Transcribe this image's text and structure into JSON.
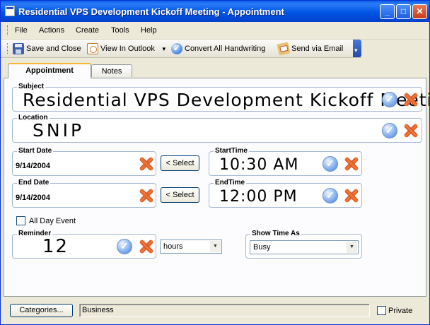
{
  "window": {
    "title": "Residential VPS Development Kickoff Meeting - Appointment",
    "controls": {
      "minimize": "_",
      "maximize": "□",
      "close": "✕"
    }
  },
  "menu": [
    "File",
    "Actions",
    "Create",
    "Tools",
    "Help"
  ],
  "toolbar": {
    "save_close": "Save and Close",
    "view_outlook": "View In Outlook",
    "convert_handwriting": "Convert All Handwriting",
    "send_email": "Send via Email"
  },
  "tabs": [
    "Appointment",
    "Notes"
  ],
  "form": {
    "subject": {
      "label": "Subject",
      "value": "Residential VPS Development Kickoff Meeting"
    },
    "location": {
      "label": "Location",
      "value": "SNIP"
    },
    "start_date": {
      "label": "Start Date",
      "value": "9/14/2004"
    },
    "start_time": {
      "label": "StartTime",
      "value": "10:30 AM"
    },
    "end_date": {
      "label": "End Date",
      "value": "9/14/2004"
    },
    "end_time": {
      "label": "EndTime",
      "value": "12:00 PM"
    },
    "select_label": "< Select",
    "all_day": "All Day Event",
    "reminder": {
      "label": "Reminder",
      "value": "12",
      "unit": "hours"
    },
    "show_time_as": {
      "label": "Show Time As",
      "value": "Busy"
    }
  },
  "bottom": {
    "categories_button": "Categories...",
    "categories_value": "Business",
    "private_label": "Private"
  }
}
